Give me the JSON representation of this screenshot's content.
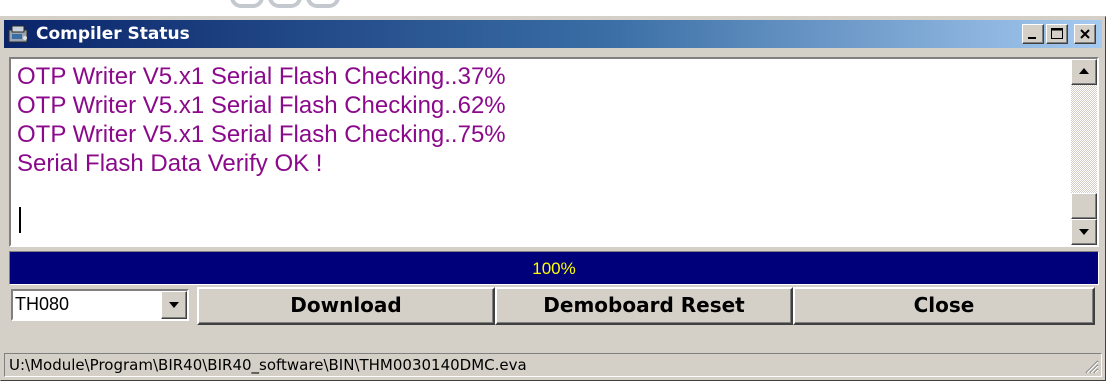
{
  "window": {
    "title": "Compiler Status",
    "icon": "compiler-app-icon"
  },
  "caption_buttons": {
    "minimize": "_",
    "maximize": "□",
    "close": "×"
  },
  "log": {
    "lines": [
      "OTP Writer V5.x1 Serial Flash Checking..37%",
      "OTP Writer V5.x1 Serial Flash Checking..62%",
      "OTP Writer V5.x1 Serial Flash Checking..75%",
      "Serial Flash Data Verify OK !"
    ],
    "text_color": "#8b0a8b"
  },
  "progress": {
    "label": "100%",
    "value": 1.0,
    "fill_color": "#00007b",
    "text_color": "#ffff00"
  },
  "device_select": {
    "value": "TH080"
  },
  "buttons": {
    "download": "Download",
    "demoboard_reset": "Demoboard Reset",
    "close": "Close"
  },
  "status_bar": {
    "path": "U:\\Module\\Program\\BIR40\\BIR40_software\\BIN\\THM0030140DMC.eva"
  },
  "colors": {
    "titlebar_start": "#0a246a",
    "titlebar_end": "#a6caf0",
    "face": "#d4d0c8"
  }
}
